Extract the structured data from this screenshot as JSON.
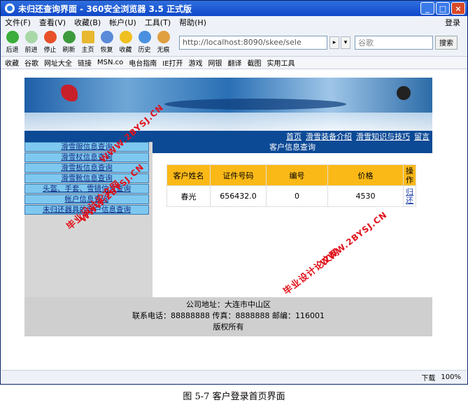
{
  "window": {
    "title": "未归还查询界面 - 360安全浏览器 3.5 正式版",
    "min": "_",
    "max": "□",
    "close": "×"
  },
  "menu": {
    "items": [
      "文件(F)",
      "查看(V)",
      "收藏(B)",
      "帐户(U)",
      "工具(T)",
      "帮助(H)"
    ],
    "login": "登录"
  },
  "toolbar": {
    "buttons": [
      "后退",
      "前进",
      "停止",
      "刷新",
      "主页",
      "恢复",
      "收藏",
      "历史",
      "无痕"
    ],
    "address": "http://localhost:8090/skee/sele",
    "search_placeholder": "谷歌",
    "search_button": "搜索"
  },
  "favorites": {
    "items": [
      "收藏",
      "谷歌",
      "网址大全",
      "链接",
      "MSN.co",
      "电台指南",
      "IE打开",
      "游戏",
      "网银",
      "翻译",
      "截图",
      "实用工具"
    ]
  },
  "site": {
    "nav": [
      "首页",
      "滑雪装备介绍",
      "滑雪知识与技巧",
      "留言"
    ],
    "sidebar": [
      "滑雪服信息查询",
      "滑雪杖信息查询",
      "滑雪板信息查询",
      "滑雪靴信息查询",
      "头盔、手套、雪镜信息查询",
      "帐户信息查询",
      "未归还器具的客户信息查询"
    ],
    "main_title": "客户信息查询",
    "table": {
      "headers": [
        "客户姓名",
        "证件号码",
        "编号",
        "价格",
        "操作"
      ],
      "rows": [
        {
          "name": "春光",
          "id": "656432.0",
          "num": "0",
          "price": "4530",
          "op": "归还"
        }
      ]
    },
    "footer": {
      "line1": "公司地址：大连市中山区",
      "line2": "联系电话：88888888 传真：8888888 邮编：116001",
      "line3": "版权所有"
    }
  },
  "status": {
    "download": "下载",
    "zoom": "100%"
  },
  "watermarks": [
    "毕业设计论文网",
    "WWW.2BYSJ.CN"
  ],
  "caption": "图 5-7  客户登录首页界面"
}
